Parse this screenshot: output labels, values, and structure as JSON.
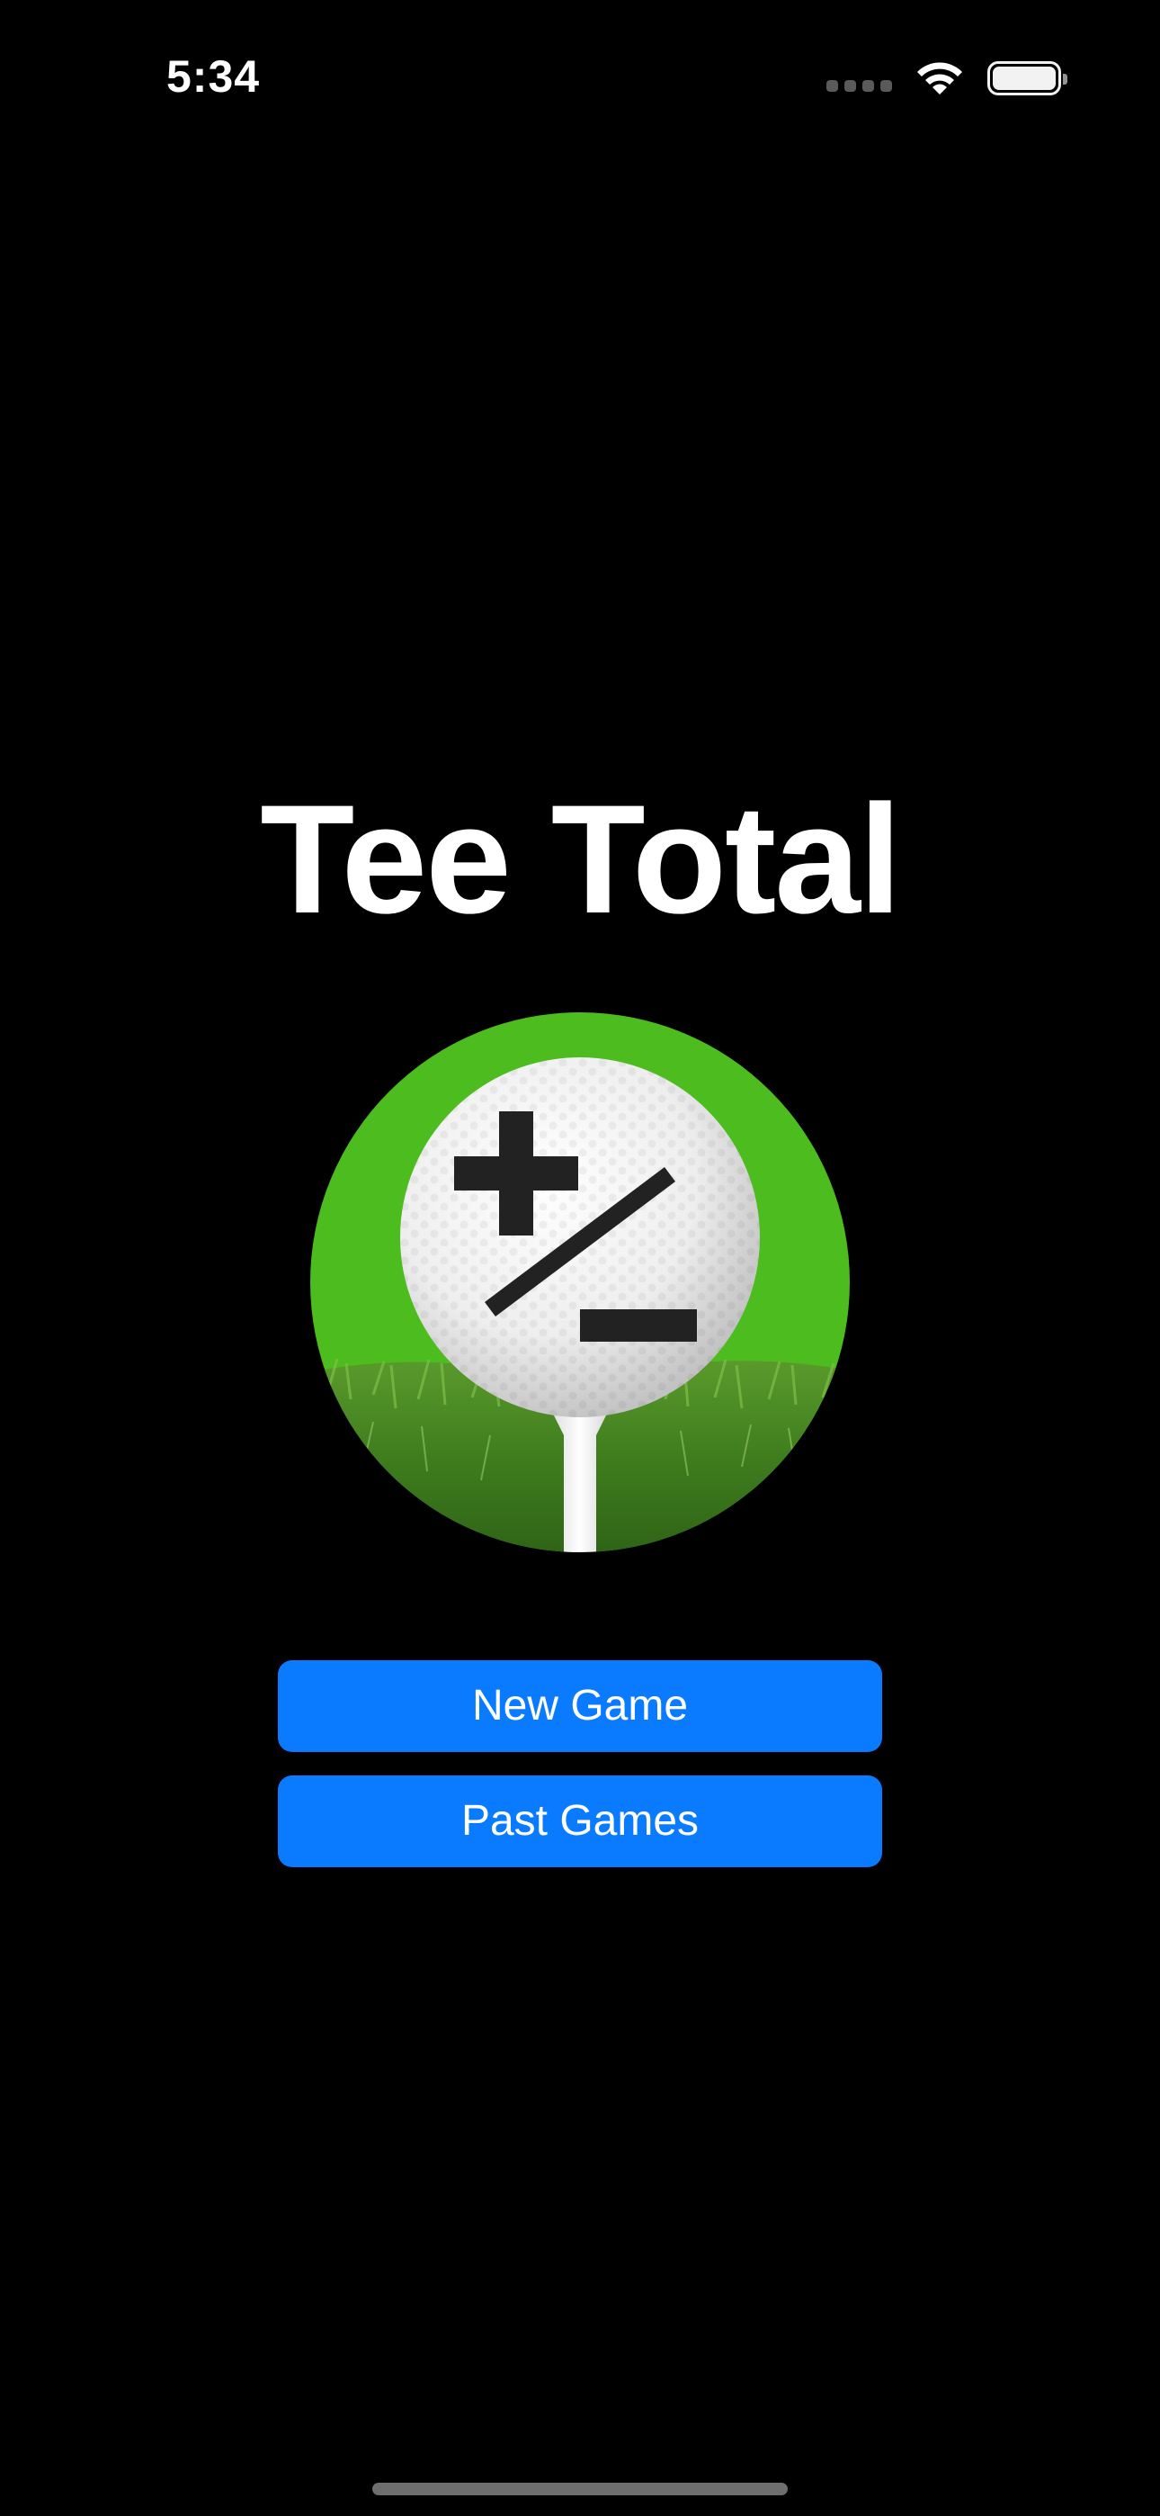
{
  "status_bar": {
    "time": "5:34",
    "icons": [
      "cellular-signal-icon",
      "wifi-icon",
      "battery-icon"
    ]
  },
  "app": {
    "title": "Tee Total",
    "logo": {
      "icon": "golf-ball-plus-minus-logo",
      "background_color": "#4cbc1e"
    }
  },
  "menu": {
    "new_game_label": "New Game",
    "past_games_label": "Past Games",
    "button_color": "#0a7bff"
  },
  "colors": {
    "background": "#000000",
    "text": "#ffffff"
  }
}
